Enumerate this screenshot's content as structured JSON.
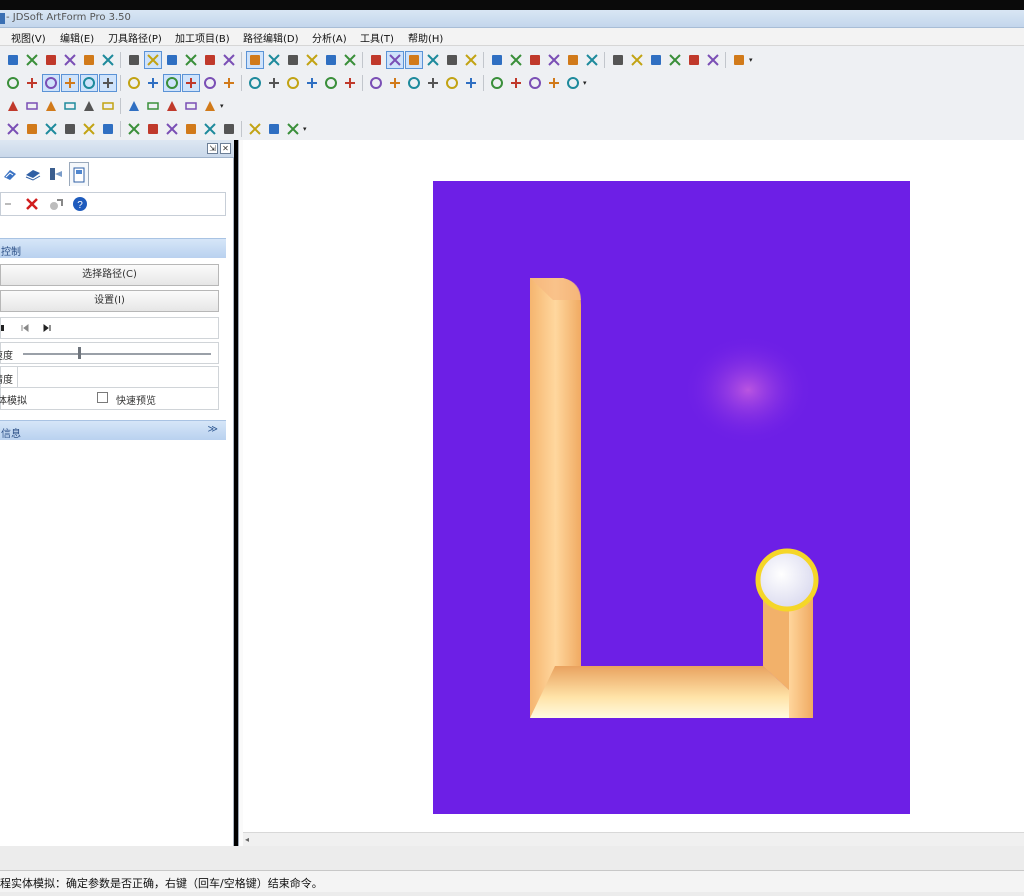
{
  "window": {
    "title": "- JDSoft ArtForm Pro 3.50"
  },
  "menu": [
    "视图(V)",
    "编辑(E)",
    "刀具路径(P)",
    "加工项目(B)",
    "路径编辑(D)",
    "分析(A)",
    "工具(T)",
    "帮助(H)"
  ],
  "toolbars": {
    "row1": [
      "save-icon",
      "undo-icon",
      "redo-icon",
      "cut-icon",
      "copy-icon",
      "paste-icon",
      "box-icon",
      "view-front-icon",
      "view-top-icon",
      "view-iso-icon",
      "view-rotate-icon",
      "select-icon",
      "shade-icon",
      "sphere-icon",
      "sphere-shaded-icon",
      "sphere-outline-icon",
      "sphere-wire-icon",
      "render-icon",
      "layer-icon",
      "active-mode-icon",
      "active-mode2-icon",
      "pin-icon",
      "pin-green-icon",
      "copy-layer-icon",
      "paste-layer-icon",
      "grid-icon",
      "arrow-left-icon",
      "arrow-right-icon",
      "zoom-window-icon",
      "zoom-in-icon",
      "zoom-out-icon",
      "zoom-all-icon",
      "zoom-fit-icon",
      "pan-icon",
      "rotate-icon",
      "orbit-icon",
      "navigate-icon"
    ],
    "row2": [
      "line-icon",
      "trim-icon",
      "extend-icon",
      "cross-icon",
      "circle-icon",
      "circle-point-icon",
      "node-icon",
      "bend-icon",
      "snap-grid-icon",
      "snap-point-icon",
      "blend1-icon",
      "blend2-icon",
      "blend3-icon",
      "split-icon",
      "delete-x-icon",
      "paint-icon",
      "brush-icon",
      "ruler-icon",
      "red-x-icon",
      "properties-icon",
      "hatch-icon",
      "pen-icon",
      "lines-icon",
      "line-weight-icon",
      "rect-icon",
      "color-bar-icon",
      "gradient-icon",
      "palette-icon",
      "eyedropper-icon"
    ],
    "row3": [
      "align-icon",
      "stack-icon",
      "spin-icon",
      "measure-icon",
      "text-tool-icon",
      "print-icon",
      "image-icon",
      "layers-icon",
      "transform-icon",
      "cutter-icon",
      "tool-path-icon"
    ],
    "row4": [
      "gear1-icon",
      "gear2-icon",
      "wrap-icon",
      "refresh-icon",
      "curve-icon",
      "chart-icon",
      "pattern-icon",
      "material-icon",
      "block-icon",
      "bricks-icon",
      "stairs-icon",
      "table-icon",
      "frame-icon",
      "mesh-icon",
      "edit-icon"
    ]
  },
  "panel": {
    "header_title": "",
    "pin_label": "⇲",
    "close_label": "✕",
    "tabs": [
      "tab-mill",
      "tab-path",
      "tab-tool",
      "tab-book"
    ],
    "actions": [
      "ok-check-icon",
      "cancel-x-icon",
      "calc-icon",
      "help-icon"
    ],
    "section_control_label": "控制",
    "select_path_label": "选择路径(C)",
    "settings_label": "设置(I)",
    "playback": [
      "play-icon",
      "prev-step-icon",
      "next-step-icon"
    ],
    "speed_label": "速度",
    "precision_label": "精度",
    "sim_label": "体模拟",
    "fast_preview_label": "快速预览",
    "section_info_label": "信息",
    "chevron": "≫"
  },
  "viewport": {
    "background_color": "#ffffff",
    "canvas_color": "#6d1fe6",
    "model_color": "#f7c98a",
    "tool_color": "#f3f3fb",
    "tool_ring_color": "#f5d628"
  },
  "status": {
    "prompt": "程实体模拟：确定参数是否正确，右键（回车/空格键）结束命令。"
  }
}
